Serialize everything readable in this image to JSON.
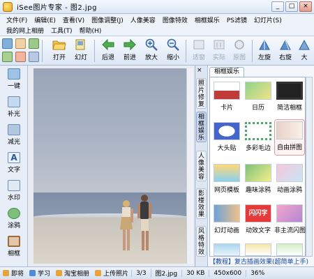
{
  "window": {
    "title": "iSee图片专家 - 图2.jpg",
    "controls": [
      "_",
      "□",
      "×"
    ]
  },
  "menu": {
    "row1": [
      "文件(F)",
      "编辑(E)",
      "查看(V)",
      "图像调整(J)",
      "人像美容",
      "图像特效",
      "相框娱乐",
      "PS滤镜",
      "幻灯片(S)"
    ],
    "row2": [
      "我的网上相册",
      "工具(T)",
      "帮助(H)"
    ]
  },
  "toolbar": {
    "buttons": [
      {
        "label": "打开",
        "icon": "open-folder-icon"
      },
      {
        "label": "幻灯",
        "icon": "slideshow-icon"
      },
      {
        "label": "后退",
        "icon": "back-arrow-icon"
      },
      {
        "label": "前进",
        "icon": "forward-arrow-icon"
      },
      {
        "label": "放大",
        "icon": "zoom-in-icon"
      },
      {
        "label": "缩小",
        "icon": "zoom-out-icon"
      },
      {
        "label": "适窗",
        "icon": "fit-window-icon",
        "disabled": true
      },
      {
        "label": "实际",
        "icon": "actual-size-icon",
        "disabled": true
      },
      {
        "label": "原图",
        "icon": "original-icon",
        "disabled": true
      },
      {
        "label": "左旋",
        "icon": "rotate-left-icon"
      },
      {
        "label": "右旋",
        "icon": "rotate-right-icon"
      },
      {
        "label": "大",
        "icon": "more-icon"
      }
    ]
  },
  "left_panel": {
    "items": [
      "一键",
      "补光",
      "减光",
      "文字",
      "水印",
      "涂鸦",
      "相框"
    ]
  },
  "tab_strip": {
    "close": "×",
    "tabs": [
      "照片修复",
      "相框娱乐",
      "人像美容",
      "影楼效果",
      "风格特效"
    ],
    "active": 1
  },
  "right_panel": {
    "tab_label": "相框娱乐",
    "thumbnails": [
      {
        "label": "卡片"
      },
      {
        "label": "日历"
      },
      {
        "label": "简洁相框"
      },
      {
        "label": "大头贴"
      },
      {
        "label": "多彩毛边"
      },
      {
        "label": "自由拼图",
        "selected": true
      },
      {
        "label": "网页模板"
      },
      {
        "label": "趣味涂鸦"
      },
      {
        "label": "动画涂鸦"
      },
      {
        "label": "幻灯动画"
      },
      {
        "label": "动效文字"
      },
      {
        "label": "非主流闪图"
      }
    ],
    "footer": "【教程】复古插画效果(超简单上手)"
  },
  "statusbar": {
    "links": [
      "即将",
      "学习",
      "淘宝相册",
      "上传照片"
    ],
    "page": "3/3",
    "filename": "图2.jpg",
    "size": "30 KB",
    "dimensions": "450x600",
    "zoom": "36%"
  },
  "colors": {
    "accent": "#1b47a8",
    "selected_border": "#e59a9a"
  }
}
